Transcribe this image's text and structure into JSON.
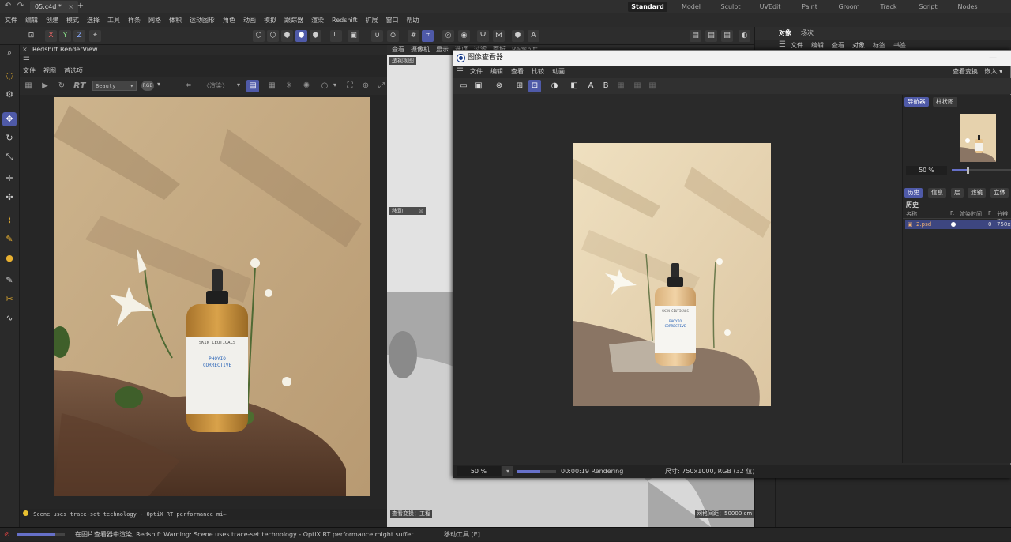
{
  "topbar": {
    "file_tab": "05.c4d *",
    "add_tab": "+",
    "layouts": [
      "Standard",
      "Model",
      "Sculpt",
      "UVEdit",
      "Paint",
      "Groom",
      "Track",
      "Script",
      "Nodes"
    ],
    "active_layout": "Standard"
  },
  "menubar": {
    "items": [
      "文件",
      "编辑",
      "创建",
      "模式",
      "选择",
      "工具",
      "样条",
      "网格",
      "体积",
      "运动图形",
      "角色",
      "动画",
      "模拟",
      "跟踪器",
      "渲染",
      "Redshift",
      "扩展",
      "窗口",
      "帮助"
    ]
  },
  "toolbar": {
    "axis_x": "X",
    "axis_y": "Y",
    "axis_z": "Z"
  },
  "renderview": {
    "title": "Redshift RenderView",
    "menu": [
      "文件",
      "视图",
      "首选项"
    ],
    "rt_label": "RT",
    "aov_select": "Beauty",
    "rgb_label": "RGB",
    "region_placeholder": "〈渲染〉",
    "status_text": "Scene uses trace-set technology - OptiX RT performance mi⋯"
  },
  "product_label": {
    "brand": "SKIN CEUTICALS",
    "name_line1": "PHOYIO",
    "name_line2": "CORRECTIVE"
  },
  "viewport": {
    "menu": [
      "查看",
      "摄像机",
      "显示",
      "选项",
      "过滤",
      "面板",
      "Redshift"
    ],
    "camera_tag": "透视视图",
    "move_tag": "移动",
    "footer_left": "查看变换：工程",
    "footer_right": "网格间距：50000 cm"
  },
  "object_manager": {
    "tabs": [
      "对象",
      "场次"
    ],
    "menu": [
      "文件",
      "编辑",
      "查看",
      "对象",
      "标签",
      "书签"
    ]
  },
  "picture_viewer": {
    "title": "图像查看器",
    "menu": [
      "文件",
      "编辑",
      "查看",
      "比较",
      "动画"
    ],
    "view_transform_label": "查看变换",
    "view_transform_value": "嵌入",
    "side_tabs": [
      "导航器",
      "柱状图"
    ],
    "zoom_value": "50 %",
    "history_tabs": [
      "历史",
      "信息",
      "层",
      "滤镜",
      "立体"
    ],
    "history_heading": "历史",
    "history_columns": [
      "名称",
      "R",
      "渲染时间",
      "F",
      "分辨率"
    ],
    "history_row": {
      "name": "2.psd",
      "frame": "0",
      "resolution": "750x"
    },
    "status_zoom": "50 %",
    "status_time": "00:00:19 Rendering",
    "status_size": "尺寸: 750x1000, RGB (32 位)",
    "progress": 0.6
  },
  "statusbar": {
    "message": "在图片查看器中渲染, Redshift Warning: Scene uses trace-set technology - OptiX RT performance might suffer",
    "tool": "移动工具 [E]",
    "progress": 0.8
  },
  "colors": {
    "accent": "#4f5aa8",
    "bg_dark": "#222222",
    "render_bg": "#c9b08a"
  }
}
